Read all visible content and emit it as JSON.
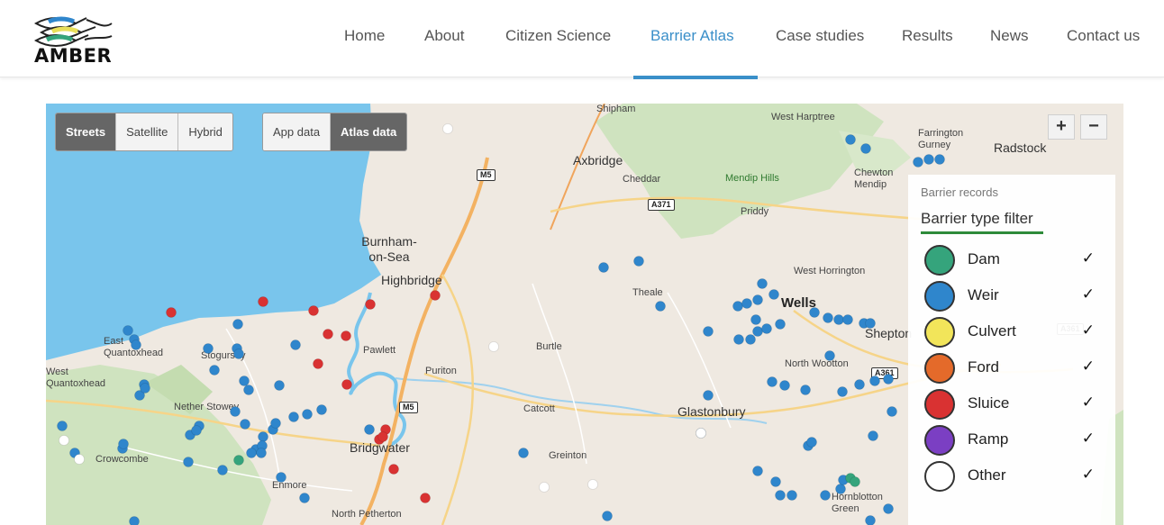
{
  "header": {
    "logo_text": "AMBER",
    "nav": [
      {
        "label": "Home",
        "active": false
      },
      {
        "label": "About",
        "active": false
      },
      {
        "label": "Citizen Science",
        "active": false
      },
      {
        "label": "Barrier Atlas",
        "active": true
      },
      {
        "label": "Case studies",
        "active": false
      },
      {
        "label": "Results",
        "active": false
      },
      {
        "label": "News",
        "active": false
      },
      {
        "label": "Contact us",
        "active": false
      }
    ]
  },
  "map": {
    "layer_buttons": [
      {
        "label": "Streets",
        "selected": true
      },
      {
        "label": "Satellite",
        "selected": false
      },
      {
        "label": "Hybrid",
        "selected": false
      }
    ],
    "data_buttons": [
      {
        "label": "App data",
        "selected": false
      },
      {
        "label": "Atlas data",
        "selected": true
      }
    ],
    "zoom_in": "+",
    "zoom_out": "−",
    "places": [
      "Shipham",
      "West Harptree",
      "Farrington Gurney",
      "Radstock",
      "Axbridge",
      "Cheddar",
      "Mendip Hills",
      "Chewton Mendip",
      "Priddy",
      "Burnham-on-Sea",
      "Highbridge",
      "Theale",
      "West Horrington",
      "Wells",
      "East Quantoxhead",
      "Stogursey",
      "Pawlett",
      "Burtle",
      "West Quantoxhead",
      "Puriton",
      "North Wootton",
      "Shepton",
      "Nether Stowey",
      "Catcott",
      "Glastonbury",
      "Bridgwater",
      "Crowcombe",
      "Greinton",
      "Enmore",
      "Hornblotton Green",
      "North Petherton"
    ],
    "roads": [
      "M5",
      "A371",
      "A361",
      "A39",
      "M5"
    ],
    "colors": {
      "water": "#79c5ec",
      "land": "#efe9e1",
      "park": "#cfe3bf",
      "dam": "#35a47c",
      "weir": "#2f86cc",
      "culvert": "#f2e55a",
      "ford": "#e46a2a",
      "sluice": "#d93232",
      "ramp": "#7b3fc3",
      "other": "#ffffff"
    }
  },
  "legend": {
    "kicker": "Barrier records",
    "title": "Barrier type filter",
    "items": [
      {
        "label": "Dam",
        "color": "#35a47c",
        "icon": "dam-icon",
        "checked": "✓"
      },
      {
        "label": "Weir",
        "color": "#2f86cc",
        "icon": "weir-icon",
        "checked": "✓"
      },
      {
        "label": "Culvert",
        "color": "#f2e55a",
        "icon": "culvert-icon",
        "checked": "✓"
      },
      {
        "label": "Ford",
        "color": "#e46a2a",
        "icon": "ford-icon",
        "checked": "✓"
      },
      {
        "label": "Sluice",
        "color": "#d93232",
        "icon": "sluice-icon",
        "checked": "✓"
      },
      {
        "label": "Ramp",
        "color": "#7b3fc3",
        "icon": "ramp-icon",
        "checked": "✓"
      },
      {
        "label": "Other",
        "color": "#ffffff",
        "icon": "other-icon",
        "checked": "✓"
      }
    ]
  }
}
